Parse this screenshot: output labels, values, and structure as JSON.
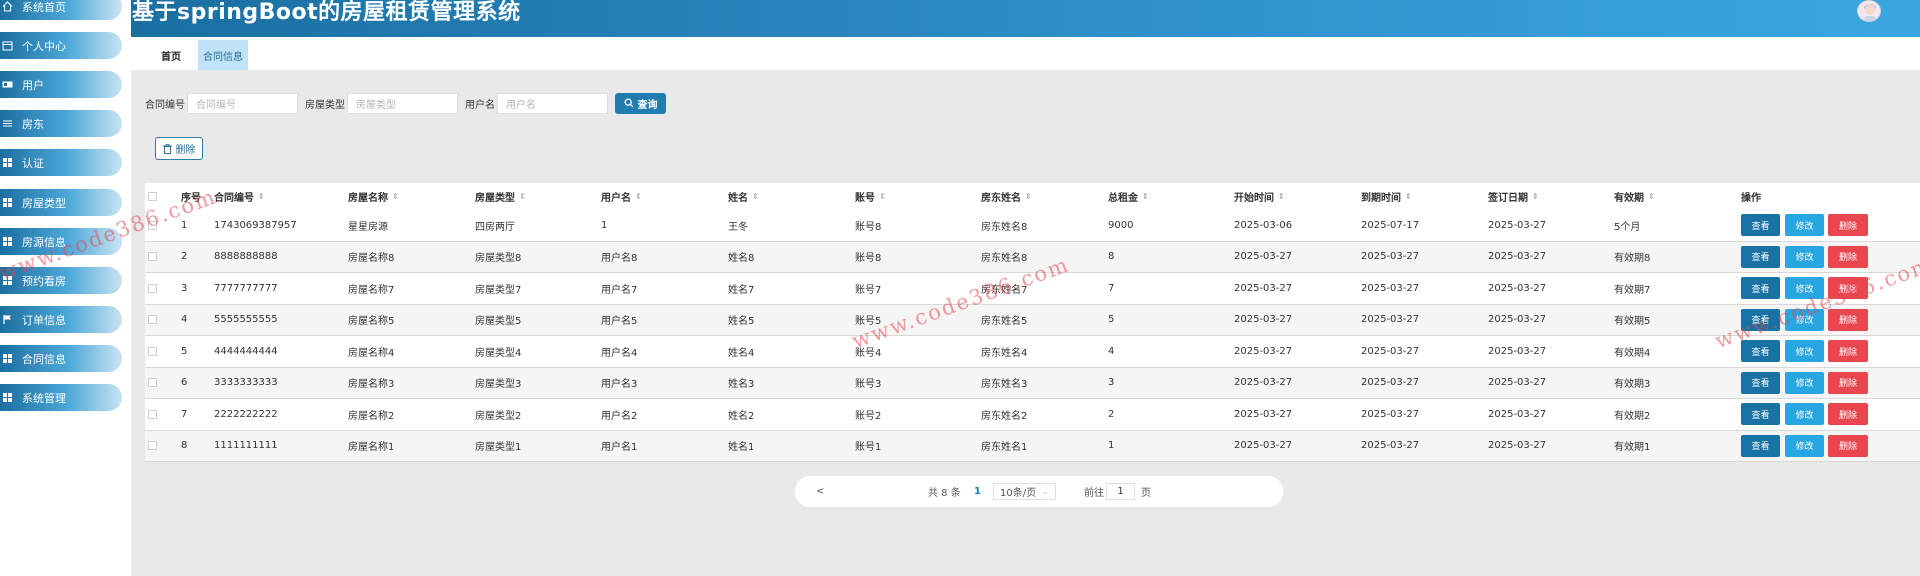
{
  "header": {
    "title": "基于springBoot的房屋租赁管理系统"
  },
  "sidebar": {
    "items": [
      {
        "label": "系统首页",
        "icon": "home-icon"
      },
      {
        "label": "个人中心",
        "icon": "calendar-icon"
      },
      {
        "label": "用户",
        "icon": "id-card-icon"
      },
      {
        "label": "房东",
        "icon": "list-icon"
      },
      {
        "label": "认证",
        "icon": "grid-icon"
      },
      {
        "label": "房屋类型",
        "icon": "grid-icon"
      },
      {
        "label": "房源信息",
        "icon": "grid-icon"
      },
      {
        "label": "预约看房",
        "icon": "grid-icon"
      },
      {
        "label": "订单信息",
        "icon": "flag-icon"
      },
      {
        "label": "合同信息",
        "icon": "grid-icon"
      },
      {
        "label": "系统管理",
        "icon": "grid-icon"
      }
    ]
  },
  "tabs": [
    {
      "label": "首页",
      "active": false
    },
    {
      "label": "合同信息",
      "active": true
    }
  ],
  "search": {
    "contract_no_label": "合同编号",
    "contract_no_placeholder": "合同编号",
    "house_type_label": "房屋类型",
    "house_type_placeholder": "房屋类型",
    "username_label": "用户名",
    "username_placeholder": "用户名",
    "query_label": "查询"
  },
  "toolbar": {
    "delete_label": "删除"
  },
  "table": {
    "columns": [
      "序号",
      "合同编号",
      "房屋名称",
      "房屋类型",
      "用户名",
      "姓名",
      "账号",
      "房东姓名",
      "总租金",
      "开始时间",
      "到期时间",
      "签订日期",
      "有效期",
      "操作"
    ],
    "rows": [
      [
        "1",
        "1743069387957",
        "星星房源",
        "四房两厅",
        "1",
        "王冬",
        "账号8",
        "房东姓名8",
        "9000",
        "2025-03-06",
        "2025-07-17",
        "2025-03-27",
        "5个月"
      ],
      [
        "2",
        "8888888888",
        "房屋名称8",
        "房屋类型8",
        "用户名8",
        "姓名8",
        "账号8",
        "房东姓名8",
        "8",
        "2025-03-27",
        "2025-03-27",
        "2025-03-27",
        "有效期8"
      ],
      [
        "3",
        "7777777777",
        "房屋名称7",
        "房屋类型7",
        "用户名7",
        "姓名7",
        "账号7",
        "房东姓名7",
        "7",
        "2025-03-27",
        "2025-03-27",
        "2025-03-27",
        "有效期7"
      ],
      [
        "4",
        "5555555555",
        "房屋名称5",
        "房屋类型5",
        "用户名5",
        "姓名5",
        "账号5",
        "房东姓名5",
        "5",
        "2025-03-27",
        "2025-03-27",
        "2025-03-27",
        "有效期5"
      ],
      [
        "5",
        "4444444444",
        "房屋名称4",
        "房屋类型4",
        "用户名4",
        "姓名4",
        "账号4",
        "房东姓名4",
        "4",
        "2025-03-27",
        "2025-03-27",
        "2025-03-27",
        "有效期4"
      ],
      [
        "6",
        "3333333333",
        "房屋名称3",
        "房屋类型3",
        "用户名3",
        "姓名3",
        "账号3",
        "房东姓名3",
        "3",
        "2025-03-27",
        "2025-03-27",
        "2025-03-27",
        "有效期3"
      ],
      [
        "7",
        "2222222222",
        "房屋名称2",
        "房屋类型2",
        "用户名2",
        "姓名2",
        "账号2",
        "房东姓名2",
        "2",
        "2025-03-27",
        "2025-03-27",
        "2025-03-27",
        "有效期2"
      ],
      [
        "8",
        "1111111111",
        "房屋名称1",
        "房屋类型1",
        "用户名1",
        "姓名1",
        "账号1",
        "房东姓名1",
        "1",
        "2025-03-27",
        "2025-03-27",
        "2025-03-27",
        "有效期1"
      ]
    ],
    "actions": {
      "view": "查看",
      "edit": "修改",
      "delete": "删除"
    }
  },
  "pagination": {
    "prev": "<",
    "total": "共 8 条",
    "current_page": "1",
    "page_size": "10条/页",
    "goto_label": "前往",
    "goto_value": "1",
    "page_suffix": "页"
  },
  "watermark": "www.code386.com",
  "colors": {
    "accent": "#1f7db0",
    "header_start": "#1a6fa1",
    "header_end": "#3aa7e0",
    "edit": "#27a6e1",
    "danger": "#e9464f",
    "active_tab": "#bfe3f7"
  }
}
